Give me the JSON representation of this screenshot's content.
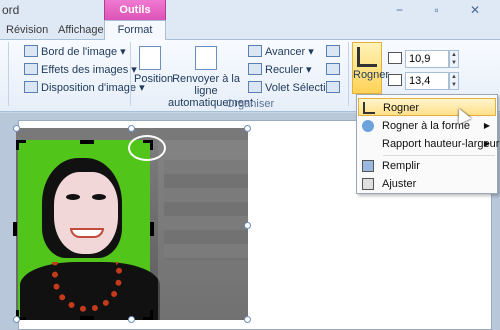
{
  "titlebar": {
    "app_title": "ord",
    "contextual_header": "Outils Image",
    "window_controls": "−  ▫  ✕"
  },
  "tabs": [
    {
      "label": "Révision"
    },
    {
      "label": "Affichage"
    },
    {
      "label": "Format"
    }
  ],
  "ribbon": {
    "picture_styles": [
      {
        "label": "Bord de l'image",
        "icon": "border-icon"
      },
      {
        "label": "Effets des images",
        "icon": "effects-icon"
      },
      {
        "label": "Disposition d'image",
        "icon": "layout-icon"
      }
    ],
    "position_label": "Position",
    "wrap_label": "Renvoyer à la ligne automatiquement",
    "wrap_line1": "Renvoyer à la ligne",
    "wrap_line2": "automatiquement",
    "arrange": [
      {
        "label": "Avancer"
      },
      {
        "label": "Reculer"
      },
      {
        "label": "Volet Sélection"
      }
    ],
    "group_label": "Organiser",
    "crop_label": "Rogner",
    "height": "10,9 cm",
    "width": "13,4 cm"
  },
  "crop_menu": {
    "items": [
      {
        "label": "Rogner",
        "submenu": false,
        "icon": "crop-icon"
      },
      {
        "label": "Rogner à la forme",
        "submenu": true,
        "icon": "shape-crop-icon"
      },
      {
        "label": "Rapport hauteur-largeur",
        "submenu": true,
        "icon": ""
      },
      {
        "label": "Remplir",
        "submenu": false,
        "icon": "fill-icon"
      },
      {
        "label": "Ajuster",
        "submenu": false,
        "icon": "fit-icon"
      }
    ]
  },
  "colors": {
    "contextual_tab": "#d94fb5",
    "highlight": "#ffe08a",
    "photo_background": "#52c51a"
  }
}
